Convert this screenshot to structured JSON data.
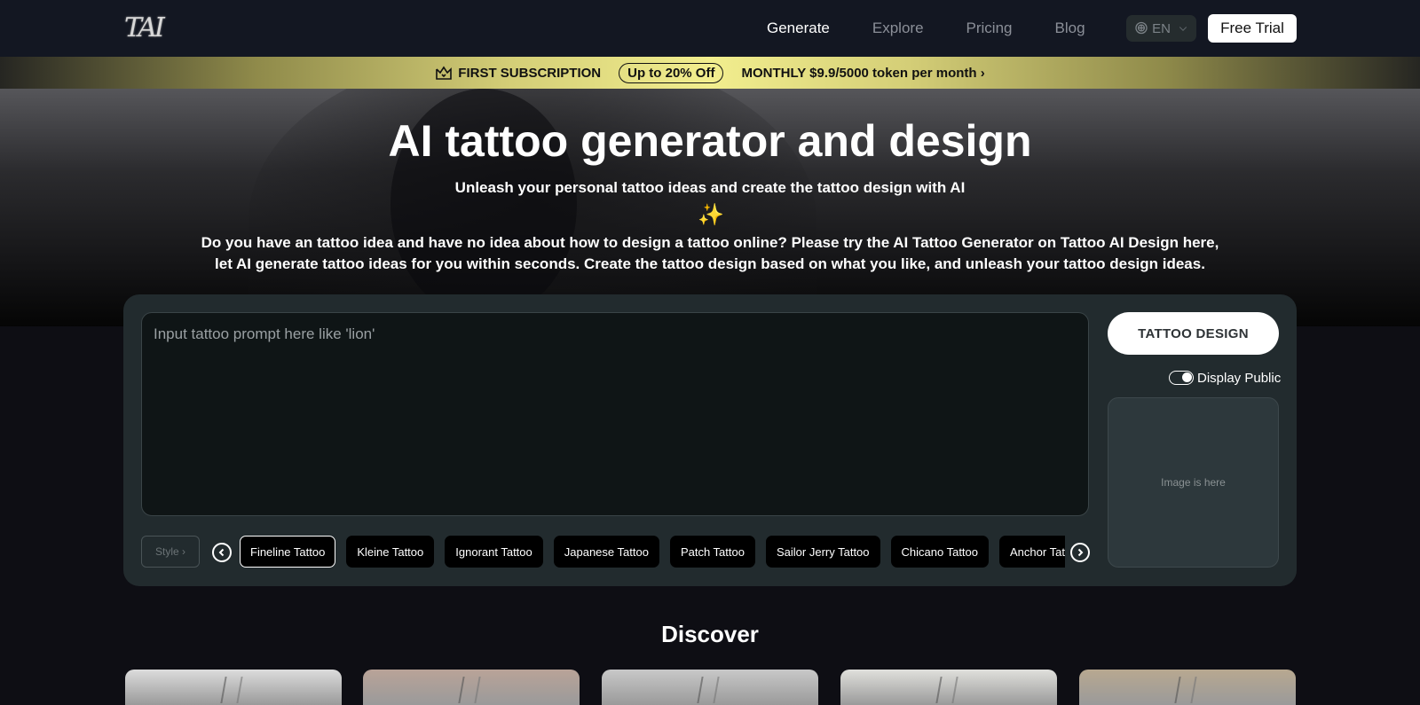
{
  "nav": {
    "logo": "TAI",
    "links": [
      {
        "label": "Generate",
        "active": true
      },
      {
        "label": "Explore",
        "active": false
      },
      {
        "label": "Pricing",
        "active": false
      },
      {
        "label": "Blog",
        "active": false
      }
    ],
    "language": {
      "icon": "globe-icon",
      "value": "EN"
    },
    "free_trial": "Free Trial"
  },
  "promo": {
    "icon": "crown-icon",
    "label": "FIRST SUBSCRIPTION",
    "badge": "Up to 20% Off",
    "cta": "MONTHLY $9.9/5000 token per month ›"
  },
  "hero": {
    "title": "AI tattoo generator and design",
    "subtitle": "Unleash your personal tattoo ideas and create the tattoo design with AI",
    "sparkle": "✨",
    "description_line1": "Do you have an tattoo idea and have no idea about how to design a tattoo online? Please try the AI Tattoo Generator on Tattoo AI Design here,",
    "description_line2": "let AI generate tattoo ideas for you within seconds. Create the tattoo design based on what you like, and unleash your tattoo design ideas."
  },
  "generator": {
    "prompt": {
      "value": "",
      "placeholder": "Input tattoo prompt here like 'lion'"
    },
    "design_button": "TATTOO DESIGN",
    "display_public": {
      "label": "Display Public",
      "enabled": true
    },
    "image_placeholder": "Image is here",
    "style_button": "Style ›",
    "styles": [
      {
        "label": "Fineline Tattoo",
        "selected": true
      },
      {
        "label": "Kleine Tattoo",
        "selected": false
      },
      {
        "label": "Ignorant Tattoo",
        "selected": false
      },
      {
        "label": "Japanese Tattoo",
        "selected": false
      },
      {
        "label": "Patch Tattoo",
        "selected": false
      },
      {
        "label": "Sailor Jerry Tattoo",
        "selected": false
      },
      {
        "label": "Chicano Tattoo",
        "selected": false
      },
      {
        "label": "Anchor Tattoo",
        "selected": false
      }
    ]
  },
  "discover": {
    "title": "Discover",
    "cards": [
      {
        "tone": "#dcdcdc"
      },
      {
        "tone": "#b9a398"
      },
      {
        "tone": "#c8c8c8"
      },
      {
        "tone": "#e0e0dc"
      },
      {
        "tone": "#b8a890"
      }
    ]
  }
}
